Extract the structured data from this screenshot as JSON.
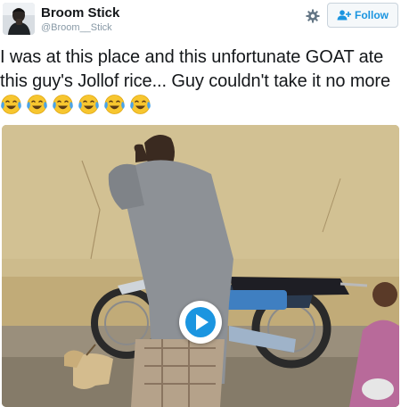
{
  "tweet": {
    "author": {
      "display_name": "Broom Stick",
      "handle": "@Broom__Stick",
      "avatar_icon": "avatar-icon"
    },
    "actions": {
      "settings_icon": "gear-icon",
      "follow_label": "Follow",
      "follow_icon": "add-user-icon"
    },
    "text": "I was at this place and this unfortunate GOAT ate this guy's Jollof rice... Guy couldn't take it no more",
    "emojis": [
      "face-with-tears-of-joy",
      "face-with-tears-of-joy",
      "face-with-tears-of-joy",
      "face-with-tears-of-joy",
      "face-with-tears-of-joy",
      "face-with-tears-of-joy"
    ],
    "media": {
      "type": "video",
      "play_icon": "play-icon"
    }
  },
  "colors": {
    "accent": "#1b95e0",
    "text": "#14171a",
    "muted": "#8899a6",
    "button_bg": "#f5f8fa",
    "emoji_face": "#f7c62f",
    "emoji_tears": "#4aa3e8"
  }
}
